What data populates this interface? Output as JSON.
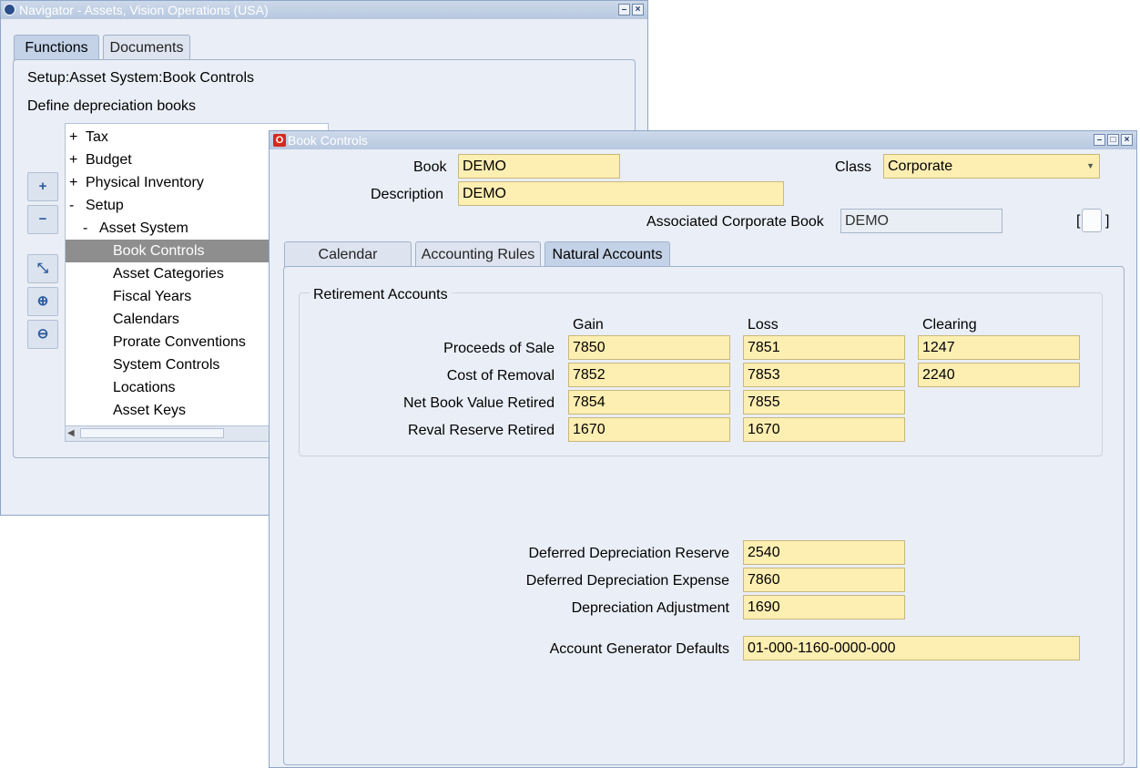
{
  "navigator": {
    "title": "Navigator - Assets, Vision Operations (USA)",
    "tabs": [
      {
        "label": "Functions",
        "active": true
      },
      {
        "label": "Documents",
        "active": false
      }
    ],
    "path": "Setup:Asset System:Book Controls",
    "description": "Define depreciation books",
    "tree": [
      {
        "prefix": "+",
        "label": "Tax",
        "level": 0
      },
      {
        "prefix": "+",
        "label": "Budget",
        "level": 0
      },
      {
        "prefix": "+",
        "label": "Physical Inventory",
        "level": 0
      },
      {
        "prefix": "-",
        "label": "Setup",
        "level": 0
      },
      {
        "prefix": "-",
        "label": "Asset System",
        "level": 1
      },
      {
        "prefix": "",
        "label": "Book Controls",
        "level": 2,
        "selected": true
      },
      {
        "prefix": "",
        "label": "Asset Categories",
        "level": 2
      },
      {
        "prefix": "",
        "label": "Fiscal Years",
        "level": 2
      },
      {
        "prefix": "",
        "label": "Calendars",
        "level": 2
      },
      {
        "prefix": "",
        "label": "Prorate Conventions",
        "level": 2
      },
      {
        "prefix": "",
        "label": "System Controls",
        "level": 2
      },
      {
        "prefix": "",
        "label": "Locations",
        "level": 2
      },
      {
        "prefix": "",
        "label": "Asset Keys",
        "level": 2
      }
    ],
    "side_buttons": [
      "expand-icon",
      "collapse-icon",
      "expand-branch-icon",
      "expand-all-icon",
      "collapse-all-icon"
    ]
  },
  "book_controls": {
    "title": "Book Controls",
    "book_label": "Book",
    "book_value": "DEMO",
    "description_label": "Description",
    "description_value": "DEMO",
    "class_label": "Class",
    "class_value": "Corporate",
    "assoc_label": "Associated Corporate Book",
    "assoc_value": "DEMO",
    "bracket_left": "[",
    "bracket_right": "]",
    "tabs": [
      {
        "label": "Calendar",
        "active": false
      },
      {
        "label": "Accounting Rules",
        "active": false
      },
      {
        "label": "Natural Accounts",
        "active": true
      }
    ],
    "retirement": {
      "legend": "Retirement Accounts",
      "columns": [
        "Gain",
        "Loss",
        "Clearing"
      ],
      "rows": [
        {
          "label": "Proceeds of Sale",
          "gain": "7850",
          "loss": "7851",
          "clearing": "1247"
        },
        {
          "label": "Cost of Removal",
          "gain": "7852",
          "loss": "7853",
          "clearing": "2240"
        },
        {
          "label": "Net Book Value Retired",
          "gain": "7854",
          "loss": "7855"
        },
        {
          "label": "Reval Reserve Retired",
          "gain": "1670",
          "loss": "1670"
        }
      ]
    },
    "deferred": [
      {
        "label": "Deferred Depreciation Reserve",
        "value": "2540"
      },
      {
        "label": "Deferred Depreciation Expense",
        "value": "7860"
      },
      {
        "label": "Depreciation Adjustment",
        "value": "1690"
      }
    ],
    "generator": {
      "label": "Account Generator Defaults",
      "value": "01-000-1160-0000-000"
    }
  },
  "colors": {
    "field": "#fdeeb2",
    "window": "#eaeef6",
    "selection": "#8e8e8e"
  }
}
